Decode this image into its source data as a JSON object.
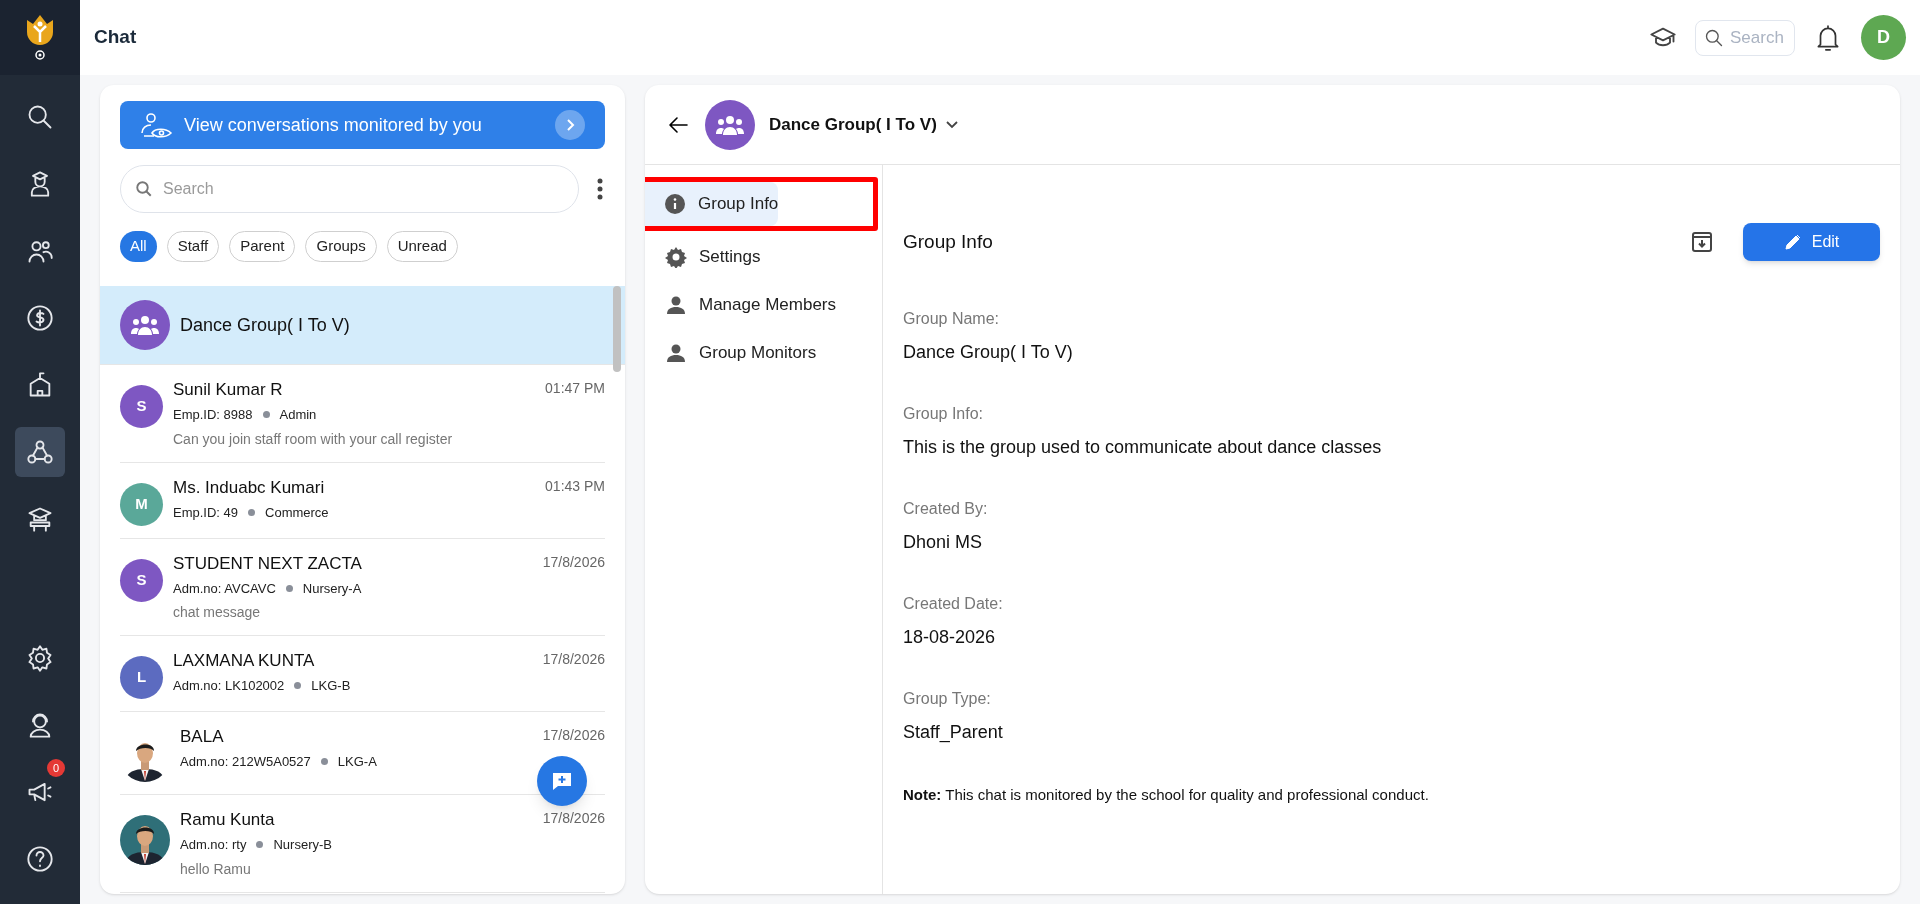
{
  "header": {
    "title": "Chat",
    "search": {
      "placeholder": "Search"
    },
    "avatar": {
      "initial": "D",
      "color": "#5ea852"
    }
  },
  "sidebar": {
    "items": [
      {
        "selected": false
      },
      {
        "selected": false
      },
      {
        "selected": false
      },
      {
        "selected": false
      },
      {
        "selected": false
      },
      {
        "selected": true
      },
      {
        "selected": false
      }
    ],
    "announcement_badge": "0"
  },
  "chat_list": {
    "monitor_banner": "View conversations monitored by you",
    "search": {
      "placeholder": "Search"
    },
    "filters": [
      {
        "label": "All",
        "selected": true
      },
      {
        "label": "Staff",
        "selected": false
      },
      {
        "label": "Parent",
        "selected": false
      },
      {
        "label": "Groups",
        "selected": false
      },
      {
        "label": "Unread",
        "selected": false
      }
    ],
    "conversations": [
      {
        "kind": "group",
        "name": "Dance Group( I To V)",
        "color": "#7e57c2",
        "selected": true
      },
      {
        "kind": "letter",
        "initial": "S",
        "color": "#7e57c2",
        "name": "Sunil Kumar R",
        "id": "Emp.ID: 8988",
        "tag": "Admin",
        "time": "01:47 PM",
        "message": "Can you join staff room with your call register",
        "selected": false
      },
      {
        "kind": "letter",
        "initial": "M",
        "color": "#5aa899",
        "name": "Ms. Induabc Kumari",
        "id": "Emp.ID: 49",
        "tag": "Commerce",
        "time": "01:43 PM",
        "selected": false
      },
      {
        "kind": "letter",
        "initial": "S",
        "color": "#7e57c2",
        "name": "STUDENT NEXT ZACTA",
        "id": "Adm.no: AVCAVC",
        "tag": "Nursery-A",
        "time": "17/8/2026",
        "message": "chat message",
        "selected": false
      },
      {
        "kind": "letter",
        "initial": "L",
        "color": "#5c6bc0",
        "name": "LAXMANA KUNTA",
        "id": "Adm.no: LK102002",
        "tag": "LKG-B",
        "time": "17/8/2026",
        "selected": false
      },
      {
        "name": "BALA",
        "id": "Adm.no: 212W5A0527",
        "tag": "LKG-A",
        "time": "17/8/2026",
        "selected": false
      },
      {
        "name": "Ramu Kunta",
        "id": "Adm.no: rty",
        "tag": "Nursery-B",
        "time": "17/8/2026",
        "message": "hello Ramu",
        "selected": false
      }
    ]
  },
  "detail": {
    "title": "Dance Group( I To V)",
    "nav": [
      {
        "label": "Group Info",
        "selected": true,
        "highlighted": true
      },
      {
        "label": "Settings",
        "selected": false,
        "highlighted": false
      },
      {
        "label": "Manage Members",
        "selected": false,
        "highlighted": false
      },
      {
        "label": "Group Monitors",
        "selected": false,
        "highlighted": false
      }
    ],
    "heading": "Group Info",
    "edit_button": "Edit",
    "fields": [
      {
        "label": "Group Name:",
        "value": "Dance Group( I To V)"
      },
      {
        "label": "Group Info:",
        "value": "This is the group used to communicate about dance classes"
      },
      {
        "label": "Created By:",
        "value": "Dhoni MS"
      },
      {
        "label": "Created Date:",
        "value": "18-08-2026"
      },
      {
        "label": "Group Type:",
        "value": "Staff_Parent"
      }
    ],
    "note": "**Note:** This chat is monitored by the school for quality and professional conduct."
  }
}
